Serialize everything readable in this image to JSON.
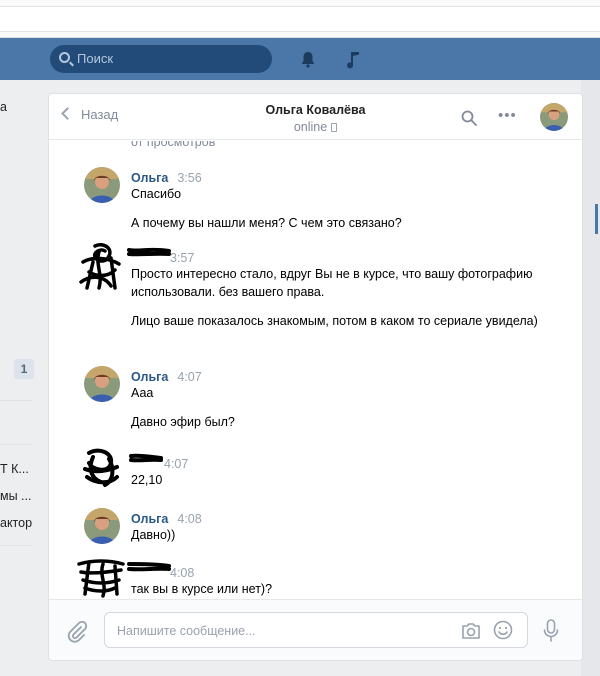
{
  "header": {
    "search_placeholder": "Поиск",
    "icons": [
      "search-icon",
      "bell-icon",
      "music-note-icon"
    ],
    "bg_color": "#4a76a8"
  },
  "sidebar_fragments": {
    "top_letter": "а",
    "badge": "1",
    "item_1": "Т К...",
    "item_2": "мы ...",
    "item_3": "актор"
  },
  "chat": {
    "back_label": "Назад",
    "peer_name": "Ольга Ковалёва",
    "peer_status": "online",
    "cut_text": "от просмотров",
    "messages": [
      {
        "author": "Ольга",
        "time": "3:56",
        "lines": [
          "Спасибо",
          "А почему вы нашли меня? С чем это связано?"
        ]
      },
      {
        "author": "",
        "time": "3:57",
        "lines": [
          "Просто интересно стало, вдруг Вы не в курсе, что вашу фотографию использовали. без вашего права.",
          "Лицо ваше показалось знакомым, потом в каком то сериале увидела)"
        ]
      },
      {
        "author": "Ольга",
        "time": "4:07",
        "lines": [
          "Ааа",
          "Давно эфир был?"
        ]
      },
      {
        "author": "",
        "time": "4:07",
        "lines": [
          "22,10"
        ]
      },
      {
        "author": "Ольга",
        "time": "4:08",
        "lines": [
          "Давно))"
        ]
      },
      {
        "author": "",
        "time": "4:08",
        "lines": [
          "так вы в курсе или нет)?"
        ]
      }
    ],
    "composer_placeholder": "Напишите сообщение...",
    "link_color": "#2a5885"
  }
}
